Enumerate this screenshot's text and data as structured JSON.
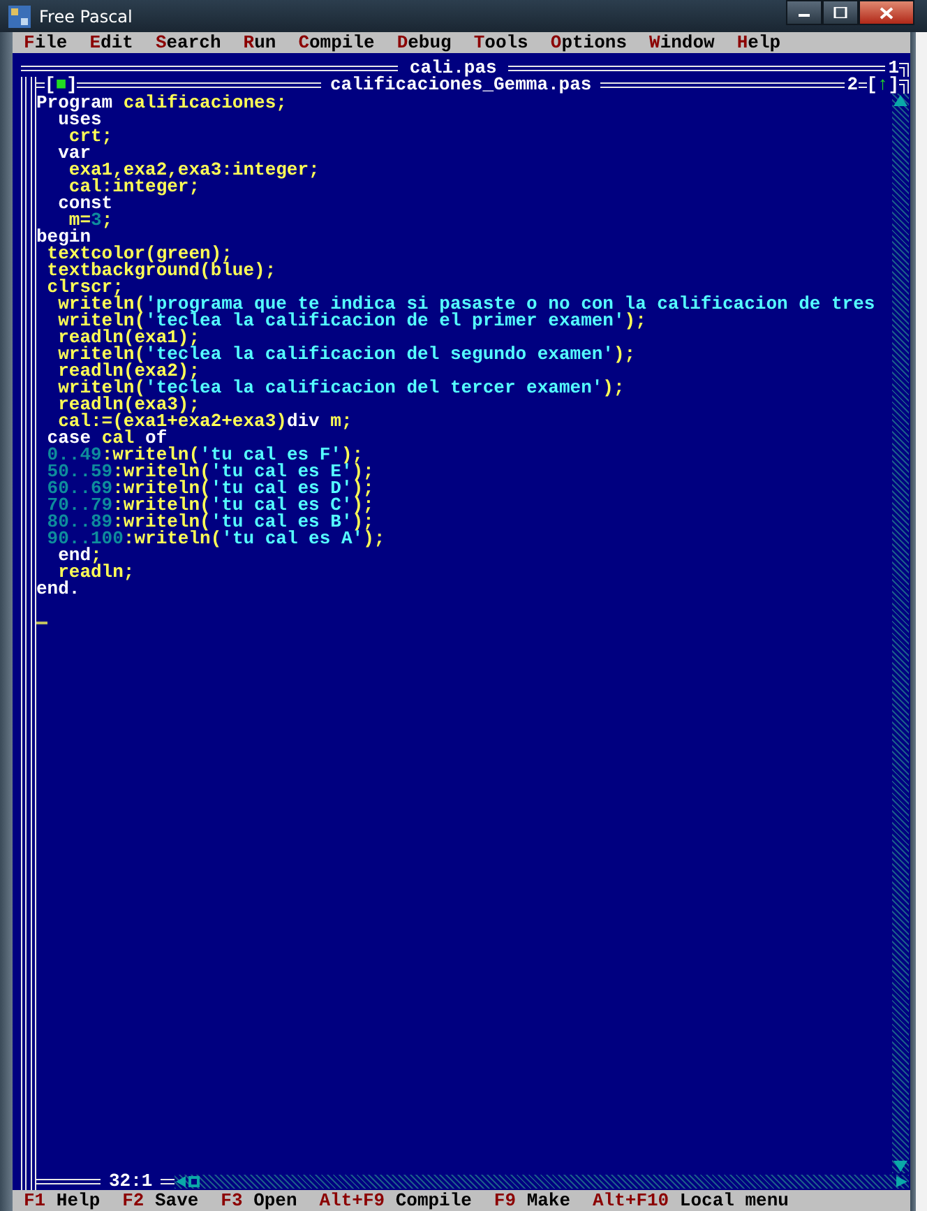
{
  "window": {
    "title": "Free Pascal"
  },
  "menu": [
    {
      "label": "File"
    },
    {
      "label": "Edit"
    },
    {
      "label": "Search"
    },
    {
      "label": "Run"
    },
    {
      "label": "Compile"
    },
    {
      "label": "Debug"
    },
    {
      "label": "Tools"
    },
    {
      "label": "Options"
    },
    {
      "label": "Window"
    },
    {
      "label": "Help"
    }
  ],
  "back_window": {
    "title": "cali.pas",
    "number": "1"
  },
  "editor": {
    "title": "calificaciones_Gemma.pas",
    "number": "2",
    "close_box": "[■]",
    "zoom_box": "[↑]",
    "position": "32:1",
    "lines": [
      [
        {
          "kind": "keyword",
          "text": "Program"
        },
        {
          "kind": "ident",
          "text": " calificaciones;"
        }
      ],
      [
        {
          "kind": "keyword",
          "text": "  uses"
        }
      ],
      [
        {
          "kind": "ident",
          "text": "   crt;"
        }
      ],
      [
        {
          "kind": "keyword",
          "text": "  var"
        }
      ],
      [
        {
          "kind": "ident",
          "text": "   exa1,exa2,exa3:integer;"
        }
      ],
      [
        {
          "kind": "ident",
          "text": "   cal:integer;"
        }
      ],
      [
        {
          "kind": "keyword",
          "text": "  const"
        }
      ],
      [
        {
          "kind": "ident",
          "text": "   m="
        },
        {
          "kind": "number",
          "text": "3"
        },
        {
          "kind": "ident",
          "text": ";"
        }
      ],
      [
        {
          "kind": "keyword",
          "text": "begin"
        }
      ],
      [
        {
          "kind": "ident",
          "text": " textcolor(green);"
        }
      ],
      [
        {
          "kind": "ident",
          "text": " textbackground(blue);"
        }
      ],
      [
        {
          "kind": "ident",
          "text": " clrscr;"
        }
      ],
      [
        {
          "kind": "ident",
          "text": "  writeln("
        },
        {
          "kind": "string",
          "text": "'programa que te indica si pasaste o no con la calificacion de tres"
        }
      ],
      [
        {
          "kind": "ident",
          "text": "  writeln("
        },
        {
          "kind": "string",
          "text": "'teclea la calificacion de el primer examen'"
        },
        {
          "kind": "ident",
          "text": ");"
        }
      ],
      [
        {
          "kind": "ident",
          "text": "  readln(exa1);"
        }
      ],
      [
        {
          "kind": "ident",
          "text": "  writeln("
        },
        {
          "kind": "string",
          "text": "'teclea la calificacion del segundo examen'"
        },
        {
          "kind": "ident",
          "text": ");"
        }
      ],
      [
        {
          "kind": "ident",
          "text": "  readln(exa2);"
        }
      ],
      [
        {
          "kind": "ident",
          "text": "  writeln("
        },
        {
          "kind": "string",
          "text": "'teclea la calificacion del tercer examen'"
        },
        {
          "kind": "ident",
          "text": ");"
        }
      ],
      [
        {
          "kind": "ident",
          "text": "  readln(exa3);"
        }
      ],
      [
        {
          "kind": "ident",
          "text": "  cal:=(exa1+exa2+exa3)"
        },
        {
          "kind": "keyword",
          "text": "div"
        },
        {
          "kind": "ident",
          "text": " m;"
        }
      ],
      [
        {
          "kind": "keyword",
          "text": " case"
        },
        {
          "kind": "ident",
          "text": " cal "
        },
        {
          "kind": "keyword",
          "text": "of"
        }
      ],
      [
        {
          "kind": "number",
          "text": " 0..49"
        },
        {
          "kind": "ident",
          "text": ":writeln("
        },
        {
          "kind": "string",
          "text": "'tu cal es F'"
        },
        {
          "kind": "ident",
          "text": ");"
        }
      ],
      [
        {
          "kind": "number",
          "text": " 50..59"
        },
        {
          "kind": "ident",
          "text": ":writeln("
        },
        {
          "kind": "string",
          "text": "'tu cal es E'"
        },
        {
          "kind": "ident",
          "text": ");"
        }
      ],
      [
        {
          "kind": "number",
          "text": " 60..69"
        },
        {
          "kind": "ident",
          "text": ":writeln("
        },
        {
          "kind": "string",
          "text": "'tu cal es D'"
        },
        {
          "kind": "ident",
          "text": ");"
        }
      ],
      [
        {
          "kind": "number",
          "text": " 70..79"
        },
        {
          "kind": "ident",
          "text": ":writeln("
        },
        {
          "kind": "string",
          "text": "'tu cal es C'"
        },
        {
          "kind": "ident",
          "text": ");"
        }
      ],
      [
        {
          "kind": "number",
          "text": " 80..89"
        },
        {
          "kind": "ident",
          "text": ":writeln("
        },
        {
          "kind": "string",
          "text": "'tu cal es B'"
        },
        {
          "kind": "ident",
          "text": ");"
        }
      ],
      [
        {
          "kind": "number",
          "text": " 90..100"
        },
        {
          "kind": "ident",
          "text": ":writeln("
        },
        {
          "kind": "string",
          "text": "'tu cal es A'"
        },
        {
          "kind": "ident",
          "text": ");"
        }
      ],
      [
        {
          "kind": "keyword",
          "text": "  end"
        },
        {
          "kind": "ident",
          "text": ";"
        }
      ],
      [
        {
          "kind": "ident",
          "text": "  readln;"
        }
      ],
      [
        {
          "kind": "keyword",
          "text": "end."
        }
      ]
    ]
  },
  "status_bar": [
    {
      "key": "F1",
      "label": "Help"
    },
    {
      "key": "F2",
      "label": "Save"
    },
    {
      "key": "F3",
      "label": "Open"
    },
    {
      "key": "Alt+F9",
      "label": "Compile"
    },
    {
      "key": "F9",
      "label": "Make"
    },
    {
      "key": "Alt+F10",
      "label": "Local menu"
    }
  ]
}
